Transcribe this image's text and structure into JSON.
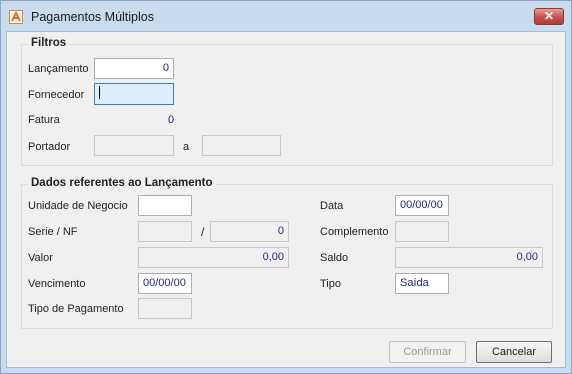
{
  "window": {
    "title": "Pagamentos Múltiplos",
    "close_symbol": "✕"
  },
  "filtros": {
    "title": "Filtros",
    "lancamento": {
      "label": "Lançamento",
      "value": "0"
    },
    "fornecedor": {
      "label": "Fornecedor",
      "value": ""
    },
    "fatura": {
      "label": "Fatura",
      "value": "0"
    },
    "portador": {
      "label": "Portador",
      "separator": "a",
      "from": "",
      "to": ""
    }
  },
  "dados": {
    "title": "Dados referentes ao Lançamento",
    "unidade_negocio": {
      "label": "Unidade de Negocio",
      "value": ""
    },
    "serie_nf": {
      "label": "Serie / NF",
      "serie": "",
      "separator": "/",
      "nf": "0"
    },
    "valor": {
      "label": "Valor",
      "value": "0,00"
    },
    "vencimento": {
      "label": "Vencimento",
      "value": "00/00/00"
    },
    "tipo_pagamento": {
      "label": "Tipo de Pagamento",
      "value": ""
    },
    "data": {
      "label": "Data",
      "value": "00/00/00"
    },
    "complemento": {
      "label": "Complemento",
      "value": ""
    },
    "saldo": {
      "label": "Saldo",
      "value": "0,00"
    },
    "tipo": {
      "label": "Tipo",
      "value": "Saída"
    }
  },
  "buttons": {
    "confirm": "Confirmar",
    "cancel": "Cancelar"
  },
  "icons": {
    "app": "app-logo-icon",
    "close": "close-icon"
  },
  "colors": {
    "titlebar": "#c9dbee",
    "close_button": "#c75050",
    "value_text": "#1c2a7a"
  }
}
